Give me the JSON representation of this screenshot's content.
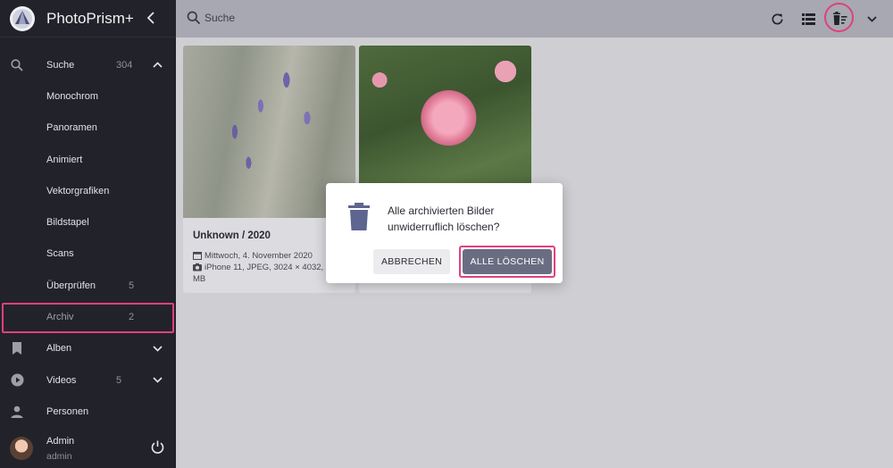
{
  "app": {
    "title": "PhotoPrism+"
  },
  "search": {
    "placeholder": "Suche"
  },
  "sidebar": {
    "items": [
      {
        "label": "Suche",
        "count": "304",
        "icon": "search-icon"
      },
      {
        "label": "Monochrom"
      },
      {
        "label": "Panoramen"
      },
      {
        "label": "Animiert"
      },
      {
        "label": "Vektorgrafiken"
      },
      {
        "label": "Bildstapel"
      },
      {
        "label": "Scans"
      },
      {
        "label": "Überprüfen",
        "count": "5"
      },
      {
        "label": "Archiv",
        "count": "2"
      },
      {
        "label": "Alben",
        "icon": "bookmark-icon"
      },
      {
        "label": "Videos",
        "count": "5",
        "icon": "play-circle-icon"
      },
      {
        "label": "Personen",
        "icon": "person-icon"
      }
    ],
    "user": {
      "name": "Admin",
      "login": "admin"
    }
  },
  "cards": [
    {
      "title": "Unknown / 2020",
      "date": "Mittwoch, 4. November 2020",
      "details": "iPhone 11, JPEG, 3024 × 4032, 2",
      "details_wrap": "MB"
    },
    {
      "title": ""
    }
  ],
  "dialog": {
    "message_line1": "Alle archivierten Bilder",
    "message_line2": "unwiderruflich löschen?",
    "cancel_label": "ABBRECHEN",
    "confirm_label": "ALLE LÖSCHEN"
  },
  "colors": {
    "highlight": "#e0407d",
    "sidebar_bg": "#22232a",
    "topbar_bg": "#a7a8b1",
    "primary_button": "#6a6c82"
  }
}
